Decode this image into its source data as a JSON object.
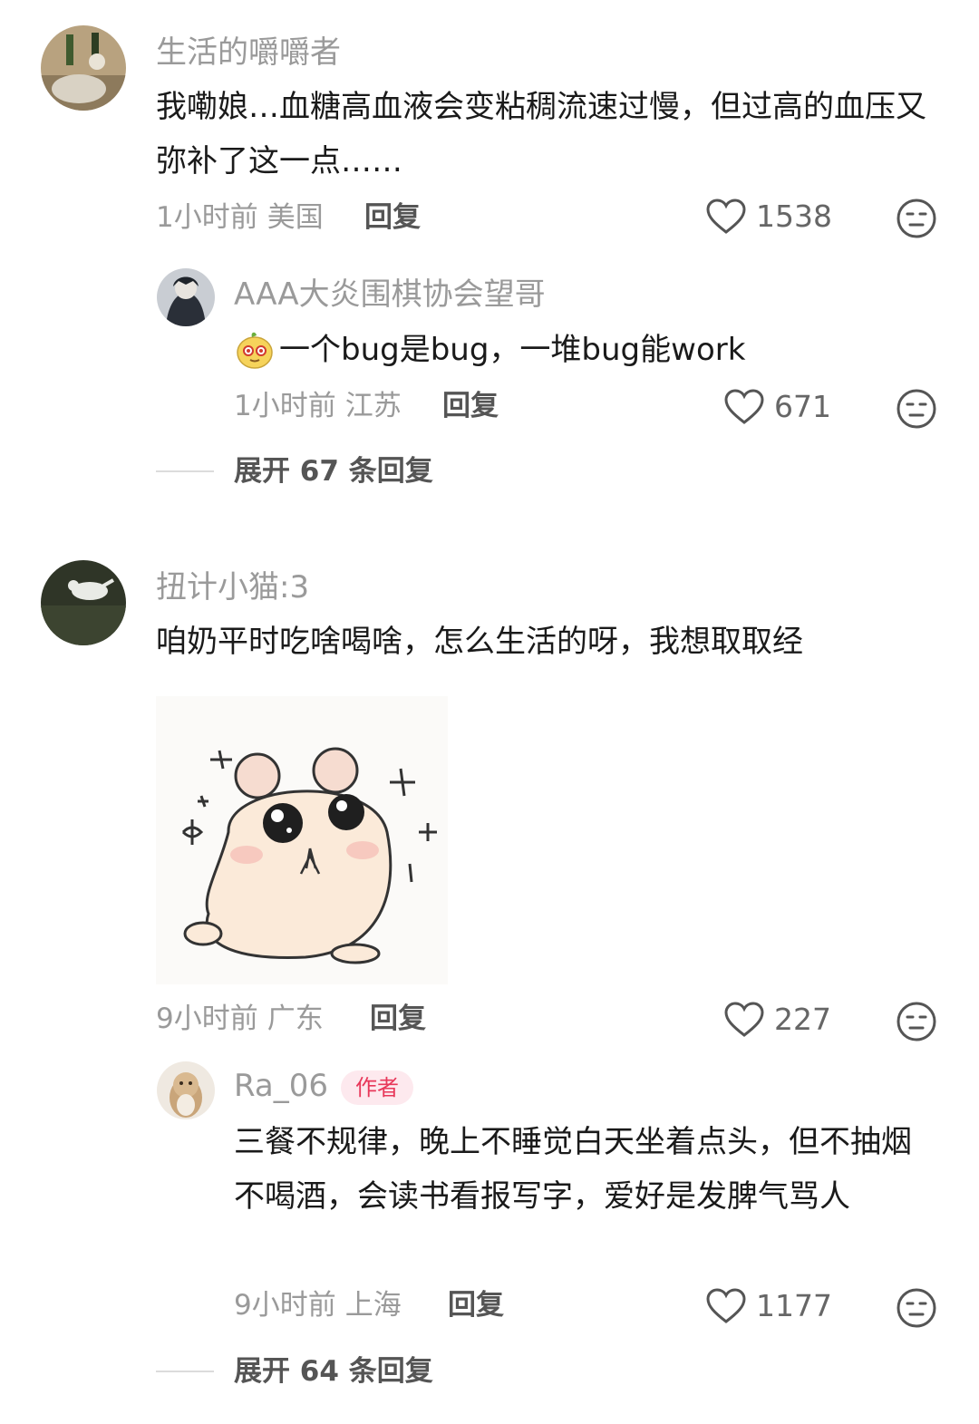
{
  "comments": [
    {
      "username": "生活的嚼嚼者",
      "text": "我嘞娘…血糖高血液会变粘稠流速过慢，但过高的血压又弥补了这一点……",
      "time": "1小时前",
      "location": "美国",
      "reply_label": "回复",
      "likes": "1538",
      "replies": [
        {
          "username": "AAA大炎围棋协会望哥",
          "text": "一个bug是bug，一堆bug能work",
          "time": "1小时前",
          "location": "江苏",
          "reply_label": "回复",
          "likes": "671"
        }
      ],
      "expand_label": "展开 67 条回复"
    },
    {
      "username": "扭计小猫:3",
      "text": "咱奶平时吃啥喝啥，怎么生活的呀，我想取取经",
      "time": "9小时前",
      "location": "广东",
      "reply_label": "回复",
      "likes": "227",
      "replies": [
        {
          "username": "Ra_06",
          "badge": "作者",
          "text": "三餐不规律，晚上不睡觉白天坐着点头，但不抽烟不喝酒，会读书看报写字，爱好是发脾气骂人",
          "time": "9小时前",
          "location": "上海",
          "reply_label": "回复",
          "likes": "1177"
        }
      ],
      "expand_label": "展开 64 条回复"
    }
  ],
  "icons": {
    "like": "heart-outline-icon",
    "dislike": "neutral-face-icon"
  },
  "colors": {
    "username": "#9a9a9a",
    "badge_bg": "#fde9ee",
    "badge_text": "#e8385a"
  }
}
